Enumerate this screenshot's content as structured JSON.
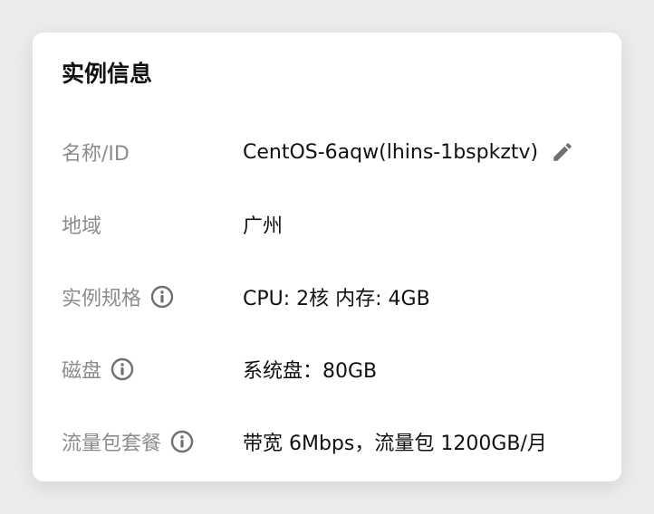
{
  "panel": {
    "title": "实例信息",
    "rows": [
      {
        "label": "名称/ID",
        "value": "CentOS-6aqw(lhins-1bspkztv)"
      },
      {
        "label": "地域",
        "value": "广州"
      },
      {
        "label": "实例规格",
        "value": "CPU: 2核 内存: 4GB"
      },
      {
        "label": "磁盘",
        "value": "系统盘：80GB"
      },
      {
        "label": "流量包套餐",
        "value": "带宽 6Mbps，流量包 1200GB/月"
      }
    ]
  },
  "icons": {
    "edit": "pencil-edit-icon",
    "info": "info-circle-icon"
  },
  "colors": {
    "label": "#8c8c8c",
    "value": "#111111",
    "icon": "#707070",
    "card": "#ffffff",
    "background": "#ececec"
  }
}
